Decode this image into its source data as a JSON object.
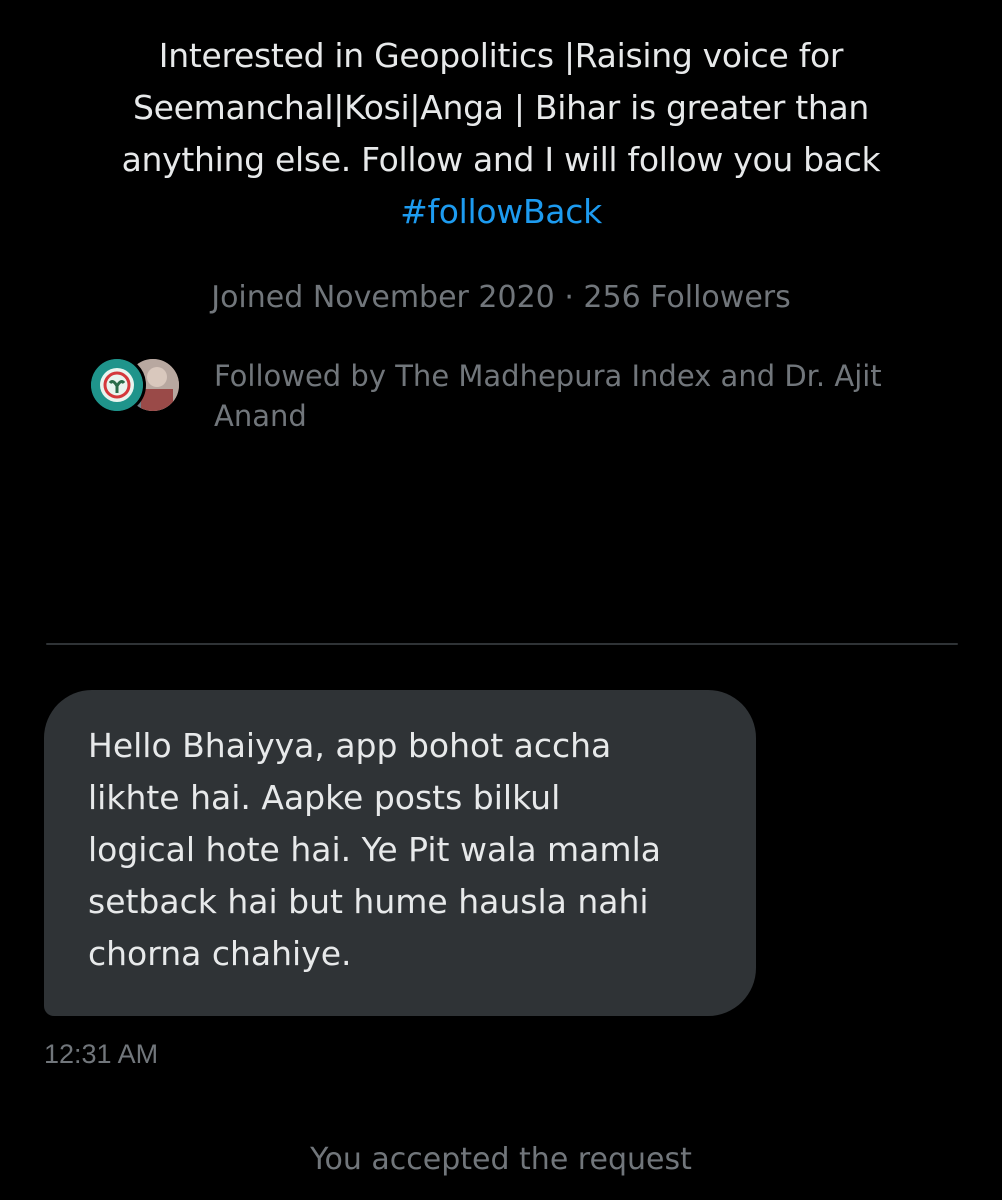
{
  "profile": {
    "bio_lines": [
      "Interested in Geopolitics |Raising voice for",
      "Seemanchal|Kosi|Anga | Bihar is greater than",
      "anything else. Follow and I will follow you back"
    ],
    "hashtag": "#followBack",
    "joined": "Joined November 2020",
    "separator": "·",
    "followers": "256 Followers",
    "followed_by_text": "Followed by The Madhepura Index and Dr. Ajit Anand",
    "accent_color": "#1d9bf0"
  },
  "message": {
    "lines": [
      "Hello Bhaiyya, app bohot accha",
      "likhte hai. Aapke posts bilkul",
      "logical hote hai. Ye Pit wala mamla",
      "setback hai but hume hausla nahi",
      "chorna chahiye."
    ],
    "time": "12:31 AM",
    "bubble_color": "#2f3336"
  },
  "system_note": "You accepted the request",
  "colors": {
    "background": "#000000",
    "text_primary": "#e7e9ea",
    "text_secondary": "#71767b"
  }
}
